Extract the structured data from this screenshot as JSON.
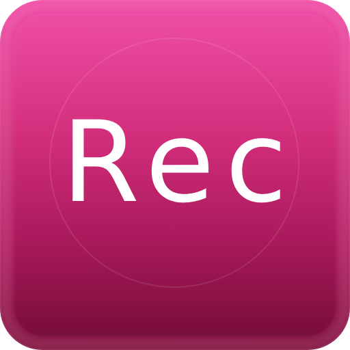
{
  "app_icon": {
    "label": "Rec",
    "colors": {
      "gradient_top": "#ef46a3",
      "gradient_mid": "#d6307f",
      "gradient_bottom": "#7f0d3b",
      "label": "#ffffff"
    }
  }
}
